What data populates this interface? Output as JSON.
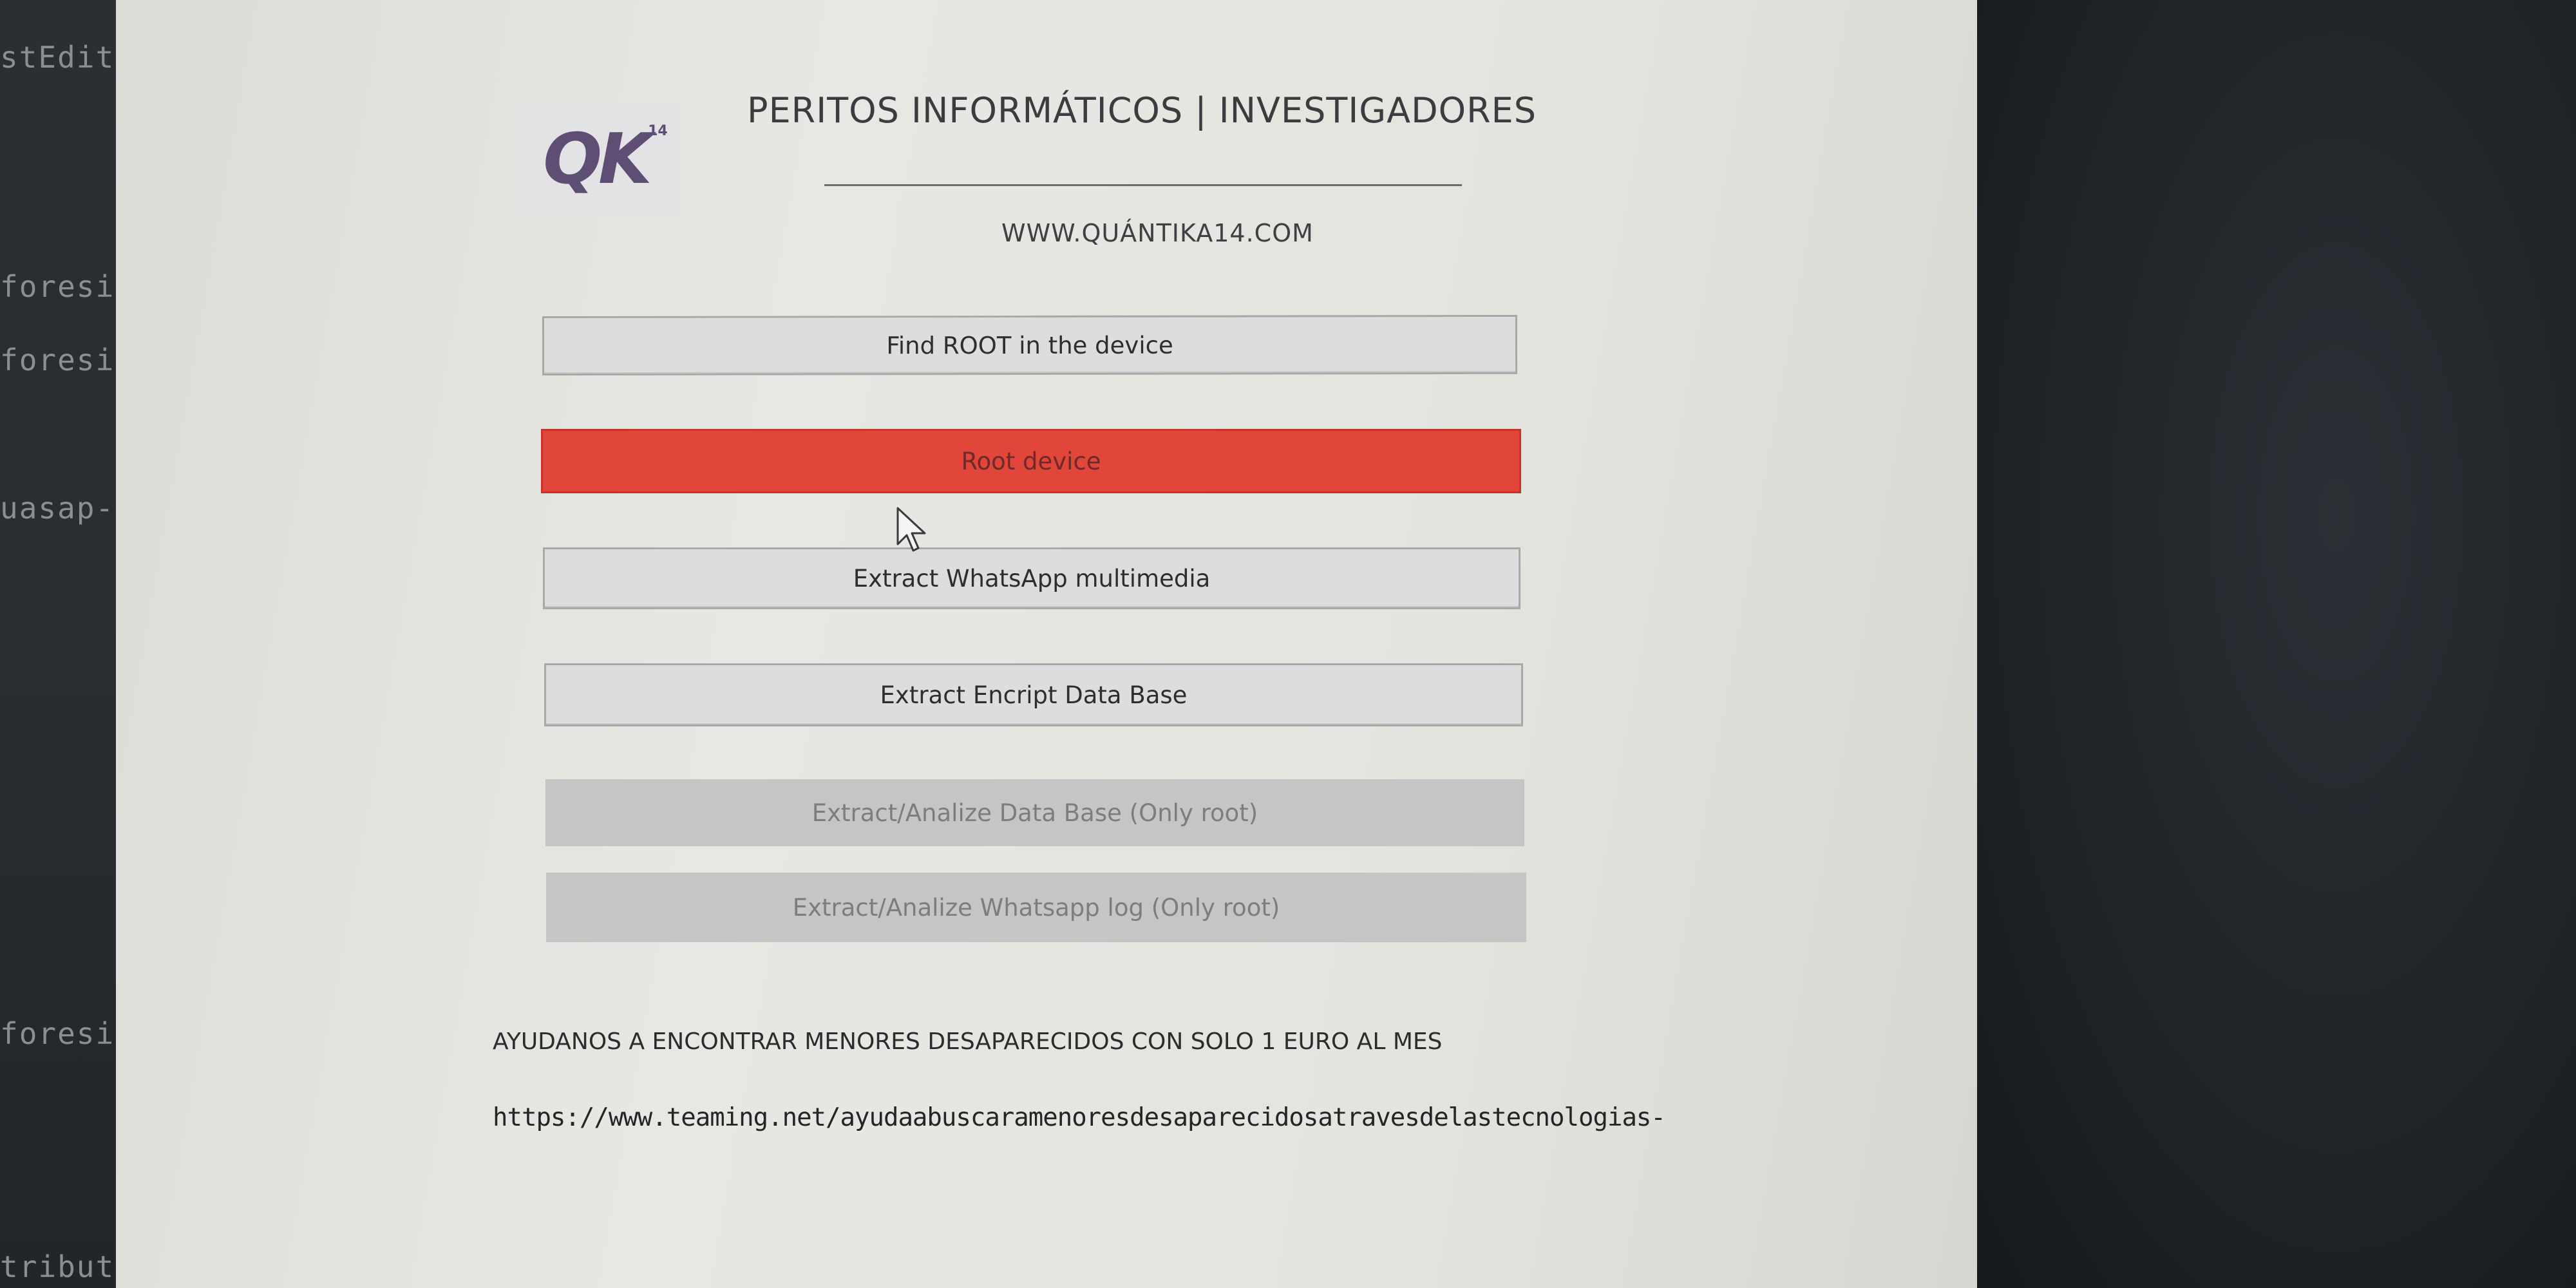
{
  "editor": {
    "lines": [
      "stEdit",
      "foresi",
      "foresi",
      "uasap-",
      "foresi",
      "tribut"
    ]
  },
  "header": {
    "logo_text": "QK",
    "logo_superscript": "14",
    "title": "PERITOS INFORMÁTICOS | INVESTIGADORES",
    "website": "WWW.QUÁNTIKA14.COM"
  },
  "buttons": {
    "find_root": "Find ROOT in the device",
    "root_device": "Root device",
    "extract_whatsapp_multimedia": "Extract WhatsApp multimedia",
    "extract_encrypt_db": "Extract Encript Data Base",
    "extract_analize_db": "Extract/Analize Data Base (Only root)",
    "extract_analize_log": "Extract/Analize Whatsapp log (Only root)"
  },
  "footer": {
    "donation_text": "AYUDANOS A ENCONTRAR MENORES DESAPARECIDOS CON SOLO 1 EURO AL MES",
    "donation_link": "https://www.teaming.net/ayudaabuscaramenoresdesaparecidosatravesdelastecnologias-"
  },
  "colors": {
    "accent_red": "#e2453a",
    "logo_purple": "#5e4e74",
    "button_gray": "#dddddd",
    "disabled_gray": "#c5c5c5"
  },
  "icons": {
    "cursor": "mouse-pointer-icon"
  }
}
